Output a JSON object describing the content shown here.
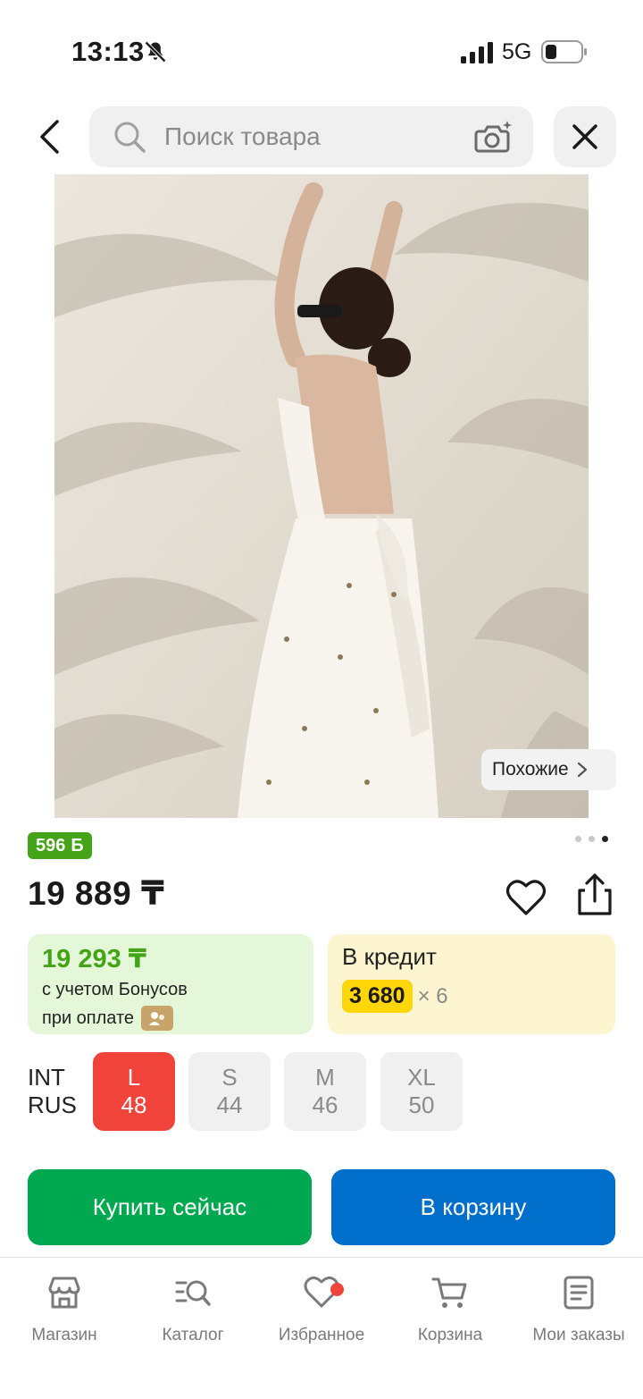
{
  "status_bar": {
    "time": "13:13",
    "network": "5G"
  },
  "search": {
    "placeholder": "Поиск товара"
  },
  "product": {
    "similar_label": "Похожие",
    "bonus_points": "596",
    "bonus_unit": "Б",
    "price": "19 889 ₸",
    "image_count": 3,
    "active_image": 3
  },
  "bonus_card": {
    "price": "19 293 ₸",
    "line1": "с учетом Бонусов",
    "line2": "при оплате"
  },
  "credit_card": {
    "title": "В кредит",
    "amount": "3 680",
    "multiplier": "× 6"
  },
  "sizes": {
    "label_int": "INT",
    "label_rus": "RUS",
    "options": [
      {
        "int": "L",
        "rus": "48",
        "selected": true
      },
      {
        "int": "S",
        "rus": "44",
        "selected": false
      },
      {
        "int": "M",
        "rus": "46",
        "selected": false
      },
      {
        "int": "XL",
        "rus": "50",
        "selected": false
      }
    ]
  },
  "actions": {
    "buy_now": "Купить сейчас",
    "add_to_cart": "В корзину"
  },
  "nav": {
    "items": [
      {
        "label": "Магазин",
        "icon": "store-icon"
      },
      {
        "label": "Каталог",
        "icon": "catalog-icon"
      },
      {
        "label": "Избранное",
        "icon": "heart-icon"
      },
      {
        "label": "Корзина",
        "icon": "cart-icon"
      },
      {
        "label": "Мои заказы",
        "icon": "orders-icon"
      }
    ]
  },
  "colors": {
    "accent_green": "#00a84f",
    "accent_blue": "#006fcc",
    "selected_size": "#f0443a",
    "bonus_green": "#44a316",
    "credit_yellow": "#ffd60a"
  }
}
